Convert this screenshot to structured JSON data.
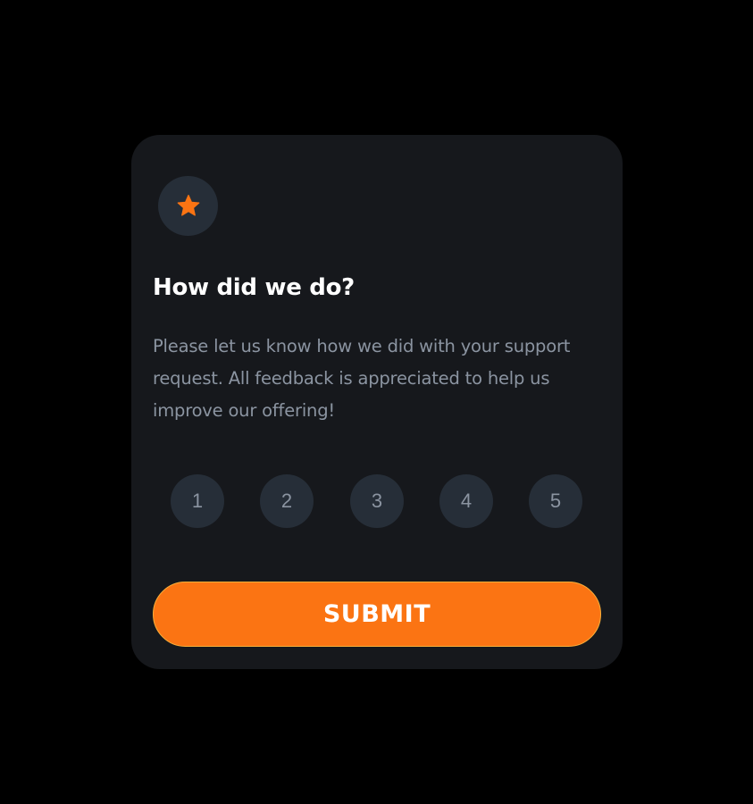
{
  "card": {
    "icon": "star-icon",
    "title": "How did we do?",
    "description": "Please let us know how we did with your support request. All feedback is appreciated to help us improve our offering!",
    "ratings": [
      "1",
      "2",
      "3",
      "4",
      "5"
    ],
    "submit_label": "SUBMIT"
  },
  "colors": {
    "background": "#000000",
    "card": "#16181c",
    "circle": "#262e38",
    "accent": "#fb7413",
    "title": "#ffffff",
    "muted": "#8b94a1"
  }
}
